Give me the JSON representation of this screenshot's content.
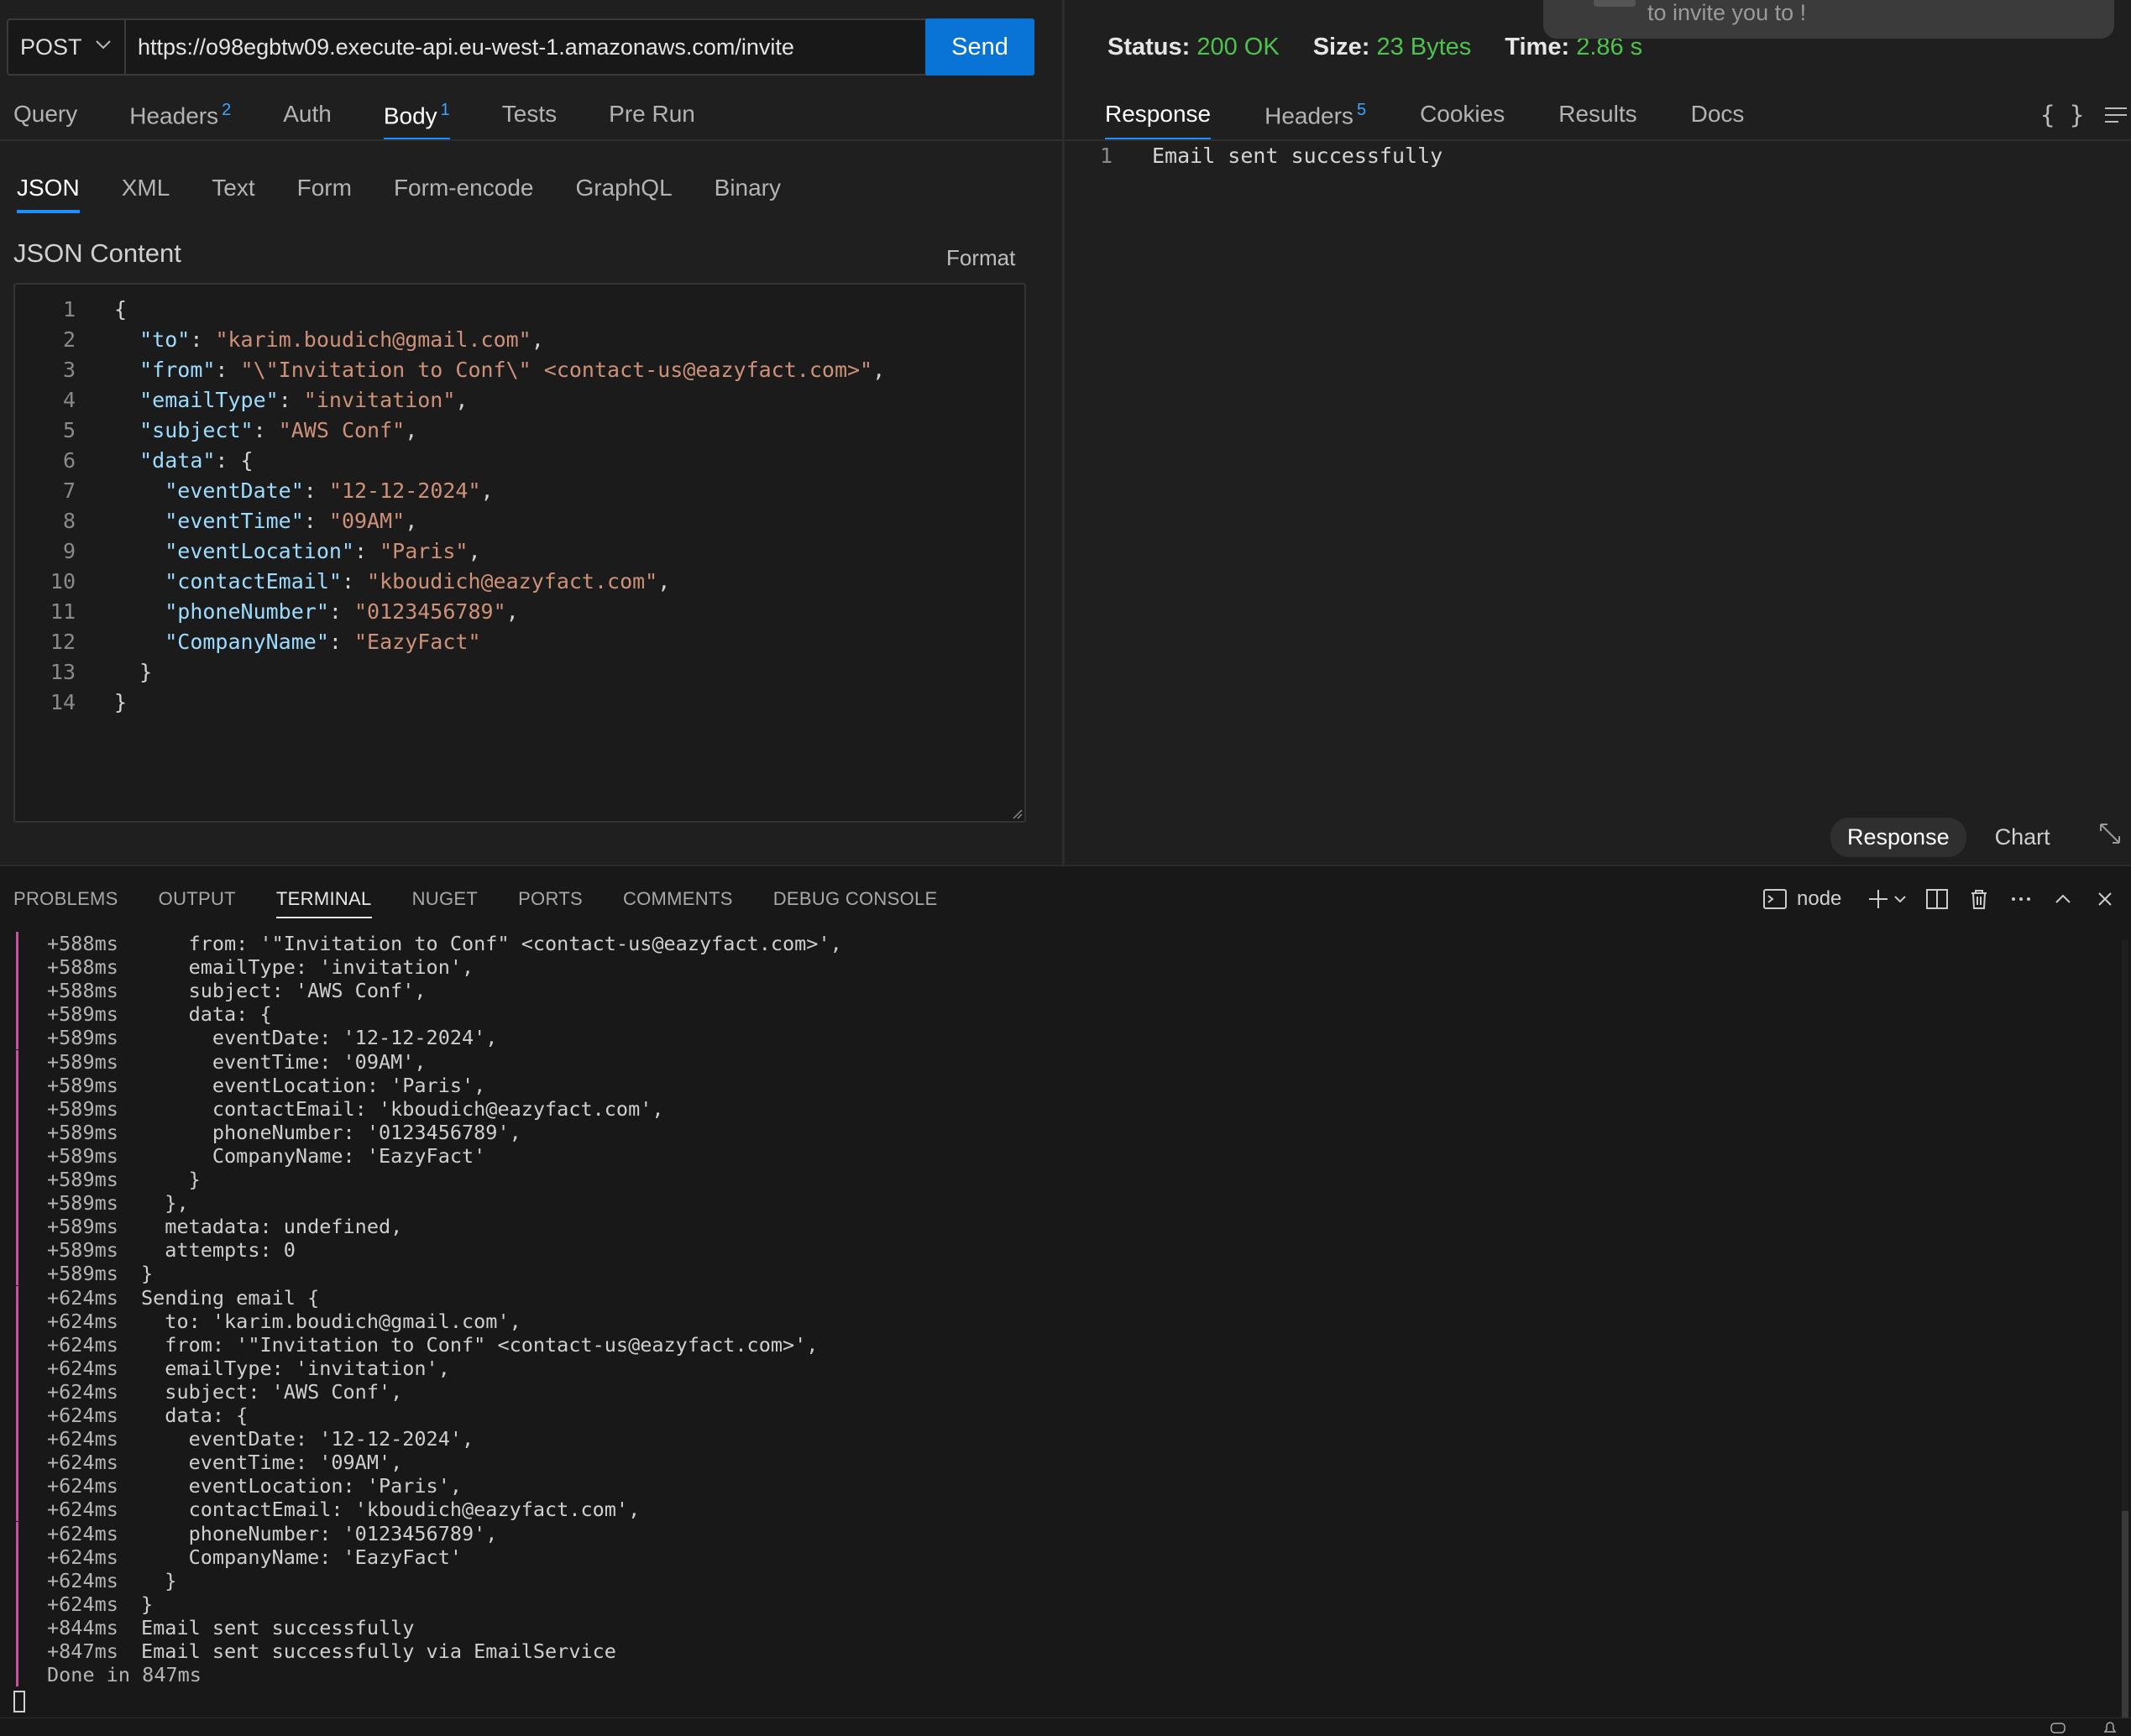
{
  "request": {
    "method": "POST",
    "url": "https://o98egbtw09.execute-api.eu-west-1.amazonaws.com/invite",
    "send_label": "Send",
    "tabs": [
      {
        "label": "Query",
        "badge": ""
      },
      {
        "label": "Headers",
        "badge": "2"
      },
      {
        "label": "Auth",
        "badge": ""
      },
      {
        "label": "Body",
        "badge": "1"
      },
      {
        "label": "Tests",
        "badge": ""
      },
      {
        "label": "Pre Run",
        "badge": ""
      }
    ],
    "active_tab": "Body",
    "body_types": [
      "JSON",
      "XML",
      "Text",
      "Form",
      "Form-encode",
      "GraphQL",
      "Binary"
    ],
    "active_body_type": "JSON",
    "content_title": "JSON Content",
    "format_label": "Format",
    "json_lines": [
      [
        [
          "p",
          "{"
        ]
      ],
      [
        [
          "p",
          "  "
        ],
        [
          "k",
          "\"to\""
        ],
        [
          "p",
          ": "
        ],
        [
          "s",
          "\"karim.boudich@gmail.com\""
        ],
        [
          "p",
          ","
        ]
      ],
      [
        [
          "p",
          "  "
        ],
        [
          "k",
          "\"from\""
        ],
        [
          "p",
          ": "
        ],
        [
          "s",
          "\"\\\"Invitation to Conf\\\" <contact-us@eazyfact.com>\""
        ],
        [
          "p",
          ","
        ]
      ],
      [
        [
          "p",
          "  "
        ],
        [
          "k",
          "\"emailType\""
        ],
        [
          "p",
          ": "
        ],
        [
          "s",
          "\"invitation\""
        ],
        [
          "p",
          ","
        ]
      ],
      [
        [
          "p",
          "  "
        ],
        [
          "k",
          "\"subject\""
        ],
        [
          "p",
          ": "
        ],
        [
          "s",
          "\"AWS Conf\""
        ],
        [
          "p",
          ","
        ]
      ],
      [
        [
          "p",
          "  "
        ],
        [
          "k",
          "\"data\""
        ],
        [
          "p",
          ": {"
        ]
      ],
      [
        [
          "p",
          "    "
        ],
        [
          "k",
          "\"eventDate\""
        ],
        [
          "p",
          ": "
        ],
        [
          "s",
          "\"12-12-2024\""
        ],
        [
          "p",
          ","
        ]
      ],
      [
        [
          "p",
          "    "
        ],
        [
          "k",
          "\"eventTime\""
        ],
        [
          "p",
          ": "
        ],
        [
          "s",
          "\"09AM\""
        ],
        [
          "p",
          ","
        ]
      ],
      [
        [
          "p",
          "    "
        ],
        [
          "k",
          "\"eventLocation\""
        ],
        [
          "p",
          ": "
        ],
        [
          "s",
          "\"Paris\""
        ],
        [
          "p",
          ","
        ]
      ],
      [
        [
          "p",
          "    "
        ],
        [
          "k",
          "\"contactEmail\""
        ],
        [
          "p",
          ": "
        ],
        [
          "s",
          "\"kboudich@eazyfact.com\""
        ],
        [
          "p",
          ","
        ]
      ],
      [
        [
          "p",
          "    "
        ],
        [
          "k",
          "\"phoneNumber\""
        ],
        [
          "p",
          ": "
        ],
        [
          "s",
          "\"0123456789\""
        ],
        [
          "p",
          ","
        ]
      ],
      [
        [
          "p",
          "    "
        ],
        [
          "k",
          "\"CompanyName\""
        ],
        [
          "p",
          ": "
        ],
        [
          "s",
          "\"EazyFact\""
        ]
      ],
      [
        [
          "p",
          "  }"
        ]
      ],
      [
        [
          "p",
          "}"
        ]
      ]
    ]
  },
  "response": {
    "toast_text": "to invite you to !",
    "status_label": "Status:",
    "status_value": "200 OK",
    "size_label": "Size:",
    "size_value": "23 Bytes",
    "time_label": "Time:",
    "time_value": "2.86 s",
    "tabs": [
      {
        "label": "Response",
        "badge": ""
      },
      {
        "label": "Headers",
        "badge": "5"
      },
      {
        "label": "Cookies",
        "badge": ""
      },
      {
        "label": "Results",
        "badge": ""
      },
      {
        "label": "Docs",
        "badge": ""
      }
    ],
    "active_tab": "Response",
    "braces_label": "{ }",
    "body_lines": [
      "Email sent successfully"
    ],
    "view_options": [
      "Response",
      "Chart"
    ],
    "active_view": "Response"
  },
  "panel": {
    "tabs": [
      "PROBLEMS",
      "OUTPUT",
      "TERMINAL",
      "NUGET",
      "PORTS",
      "COMMENTS",
      "DEBUG CONSOLE"
    ],
    "active_tab": "TERMINAL",
    "shell_label": "node",
    "terminal_lines": [
      {
        "ts": "+588ms",
        "text": "    from: '\"Invitation to Conf\" <contact-us@eazyfact.com>',"
      },
      {
        "ts": "+588ms",
        "text": "    emailType: 'invitation',"
      },
      {
        "ts": "+588ms",
        "text": "    subject: 'AWS Conf',"
      },
      {
        "ts": "+589ms",
        "text": "    data: {"
      },
      {
        "ts": "+589ms",
        "text": "      eventDate: '12-12-2024',"
      },
      {
        "ts": "+589ms",
        "text": "      eventTime: '09AM',"
      },
      {
        "ts": "+589ms",
        "text": "      eventLocation: 'Paris',"
      },
      {
        "ts": "+589ms",
        "text": "      contactEmail: 'kboudich@eazyfact.com',"
      },
      {
        "ts": "+589ms",
        "text": "      phoneNumber: '0123456789',"
      },
      {
        "ts": "+589ms",
        "text": "      CompanyName: 'EazyFact'"
      },
      {
        "ts": "+589ms",
        "text": "    }"
      },
      {
        "ts": "+589ms",
        "text": "  },"
      },
      {
        "ts": "+589ms",
        "text": "  metadata: undefined,"
      },
      {
        "ts": "+589ms",
        "text": "  attempts: 0"
      },
      {
        "ts": "+589ms",
        "text": "}"
      },
      {
        "ts": "+624ms",
        "text": "Sending email {"
      },
      {
        "ts": "+624ms",
        "text": "  to: 'karim.boudich@gmail.com',"
      },
      {
        "ts": "+624ms",
        "text": "  from: '\"Invitation to Conf\" <contact-us@eazyfact.com>',"
      },
      {
        "ts": "+624ms",
        "text": "  emailType: 'invitation',"
      },
      {
        "ts": "+624ms",
        "text": "  subject: 'AWS Conf',"
      },
      {
        "ts": "+624ms",
        "text": "  data: {"
      },
      {
        "ts": "+624ms",
        "text": "    eventDate: '12-12-2024',"
      },
      {
        "ts": "+624ms",
        "text": "    eventTime: '09AM',"
      },
      {
        "ts": "+624ms",
        "text": "    eventLocation: 'Paris',"
      },
      {
        "ts": "+624ms",
        "text": "    contactEmail: 'kboudich@eazyfact.com',"
      },
      {
        "ts": "+624ms",
        "text": "    phoneNumber: '0123456789',"
      },
      {
        "ts": "+624ms",
        "text": "    CompanyName: 'EazyFact'"
      },
      {
        "ts": "+624ms",
        "text": "  }"
      },
      {
        "ts": "+624ms",
        "text": "}"
      },
      {
        "ts": "+844ms",
        "text": "Email sent successfully"
      },
      {
        "ts": "+847ms",
        "text": "Email sent successfully via EmailService"
      }
    ],
    "done_line": "Done in 847ms"
  },
  "colors": {
    "accent": "#1d8fff",
    "send_button": "#0a74d6",
    "success": "#4ec24e",
    "json_key": "#9cdcfe",
    "json_string": "#ce9178",
    "terminal_gutter": "#c94fa0"
  }
}
